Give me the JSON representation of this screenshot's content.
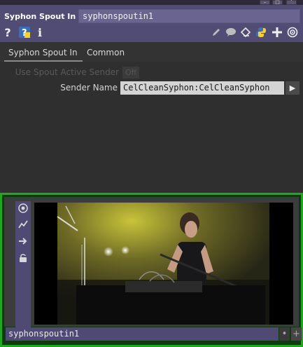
{
  "operator": {
    "type_label": "Syphon Spout In",
    "name": "syphonspoutin1"
  },
  "header_icons": {
    "left": [
      "help-icon",
      "python-help-icon",
      "info-icon"
    ],
    "right": [
      "pencil-icon",
      "comment-icon",
      "clone-icon",
      "python-icon",
      "plus-icon",
      "target-icon"
    ]
  },
  "tabs": [
    {
      "label": "Syphon Spout In",
      "active": true
    },
    {
      "label": "Common",
      "active": false
    }
  ],
  "params": {
    "use_spout_label": "Use Spout Active Sender",
    "use_spout_value": "Off",
    "sender_label": "Sender Name",
    "sender_value": "CelCleanSyphon:CelCleanSyphon",
    "sender_button": "▶"
  },
  "viewer": {
    "tools": [
      "viewer-active-icon",
      "graph-icon",
      "arrow-right-icon",
      "lock-icon"
    ],
    "name_label": "syphonspoutin1",
    "corner_plus": "+"
  },
  "colors": {
    "header": "#514c73",
    "accent_green": "#1fa81f",
    "name_field": "#6a6590"
  }
}
